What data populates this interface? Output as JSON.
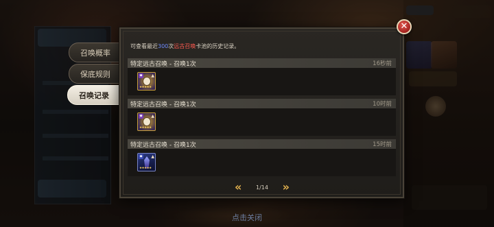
{
  "tabs": [
    {
      "label": "召唤概率"
    },
    {
      "label": "保底规则"
    },
    {
      "label": "召唤记录",
      "active": true
    }
  ],
  "notice": {
    "prefix": "可查看最近",
    "count": "300",
    "mid": "次",
    "pool": "远古召唤",
    "suffix": "卡池的历史记录。"
  },
  "records": [
    {
      "title": "特定远古召唤 - 召唤1次",
      "time": "16秒前",
      "card_icon": "hero-card-gold-icon"
    },
    {
      "title": "特定远古召唤 - 召唤1次",
      "time": "10时前",
      "card_icon": "hero-card-gold-icon"
    },
    {
      "title": "特定远古召唤 - 召唤1次",
      "time": "15时前",
      "card_icon": "hero-card-blue-icon"
    }
  ],
  "pager": {
    "label": "1/14",
    "prev_icon": "double-chevron-left-icon",
    "next_icon": "double-chevron-right-icon"
  },
  "close": {
    "icon": "close-icon",
    "glyph": "✕"
  },
  "footer": {
    "tap_close": "点击关闭"
  },
  "colors": {
    "accent_gold": "#e2b14e",
    "highlight_blue": "#6f8cff",
    "highlight_red": "#ff5a50",
    "close_red": "#c33a33"
  }
}
